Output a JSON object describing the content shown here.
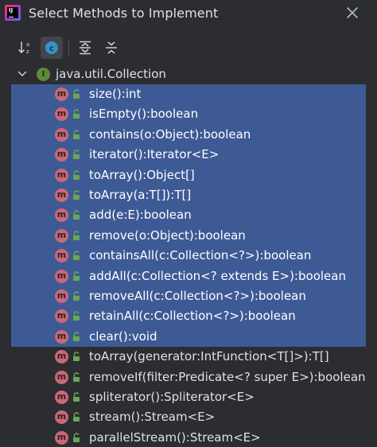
{
  "window": {
    "title": "Select Methods to Implement",
    "close_icon": "close-icon",
    "app_icon": "intellij-idea-icon"
  },
  "toolbar": {
    "buttons": [
      {
        "icon": "sort-alphabetically-icon",
        "active": false
      },
      {
        "icon": "show-classes-icon",
        "active": true
      },
      {
        "icon": "expand-all-icon",
        "active": false
      },
      {
        "icon": "collapse-all-icon",
        "active": false
      }
    ]
  },
  "colors": {
    "background": "#2b2d30",
    "selection": "#3e5a95",
    "method_icon": "#c76a78",
    "interface_icon": "#5f8a3a",
    "lock_icon": "#6aa84f"
  },
  "tree": {
    "root": {
      "label": "java.util.Collection",
      "icon": "interface-icon",
      "expanded": true
    },
    "methods": [
      {
        "label": "size():int",
        "selected": true
      },
      {
        "label": "isEmpty():boolean",
        "selected": true
      },
      {
        "label": "contains(o:Object):boolean",
        "selected": true
      },
      {
        "label": "iterator():Iterator<E>",
        "selected": true
      },
      {
        "label": "toArray():Object[]",
        "selected": true
      },
      {
        "label": "toArray(a:T[]):T[]",
        "selected": true
      },
      {
        "label": "add(e:E):boolean",
        "selected": true
      },
      {
        "label": "remove(o:Object):boolean",
        "selected": true
      },
      {
        "label": "containsAll(c:Collection<?>):boolean",
        "selected": true
      },
      {
        "label": "addAll(c:Collection<? extends E>):boolean",
        "selected": true
      },
      {
        "label": "removeAll(c:Collection<?>):boolean",
        "selected": true
      },
      {
        "label": "retainAll(c:Collection<?>):boolean",
        "selected": true
      },
      {
        "label": "clear():void",
        "selected": true
      },
      {
        "label": "toArray(generator:IntFunction<T[]>):T[]",
        "selected": false
      },
      {
        "label": "removeIf(filter:Predicate<? super E>):boolean",
        "selected": false
      },
      {
        "label": "spliterator():Spliterator<E>",
        "selected": false
      },
      {
        "label": "stream():Stream<E>",
        "selected": false
      },
      {
        "label": "parallelStream():Stream<E>",
        "selected": false
      }
    ],
    "method_icon_letter": "m",
    "interface_icon_letter": "I"
  }
}
